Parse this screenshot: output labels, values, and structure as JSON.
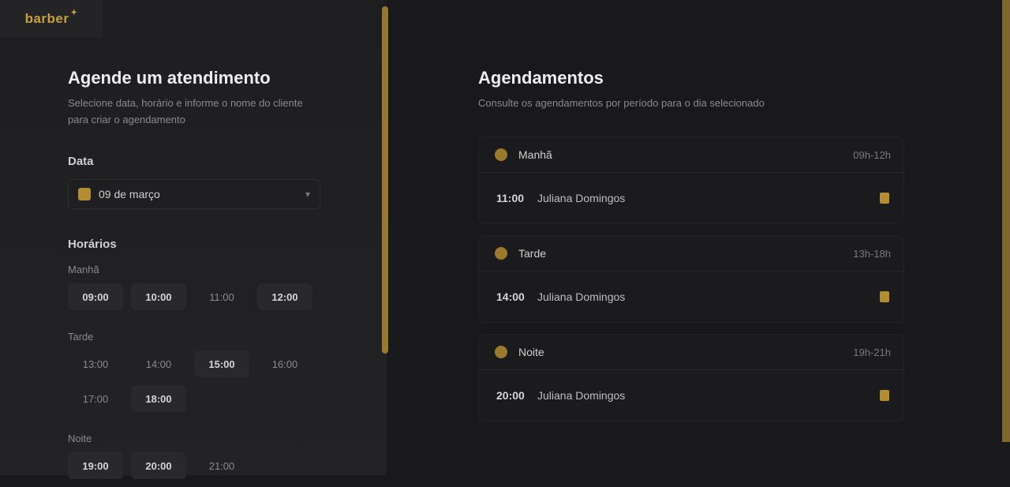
{
  "brand": {
    "name": "barber",
    "accent": "#c6a13c"
  },
  "left": {
    "title": "Agende um atendimento",
    "subtitle": "Selecione data, horário e informe o nome do cliente para criar o agendamento",
    "date_label": "Data",
    "date_value": "09 de março",
    "hours_label": "Horários",
    "periods": [
      {
        "name": "Manhã",
        "slots": [
          {
            "time": "09:00",
            "on": true
          },
          {
            "time": "10:00",
            "on": true
          },
          {
            "time": "11:00",
            "on": false
          },
          {
            "time": "12:00",
            "on": true
          }
        ]
      },
      {
        "name": "Tarde",
        "slots": [
          {
            "time": "13:00",
            "on": false
          },
          {
            "time": "14:00",
            "on": false
          },
          {
            "time": "15:00",
            "on": true
          },
          {
            "time": "16:00",
            "on": false
          },
          {
            "time": "17:00",
            "on": false
          },
          {
            "time": "18:00",
            "on": true
          }
        ]
      },
      {
        "name": "Noite",
        "slots": [
          {
            "time": "19:00",
            "on": true
          },
          {
            "time": "20:00",
            "on": true
          },
          {
            "time": "21:00",
            "on": false
          }
        ]
      }
    ]
  },
  "right": {
    "title": "Agendamentos",
    "subtitle": "Consulte os agendamentos por período para o dia selecionado",
    "periods": [
      {
        "name": "Manhã",
        "range": "09h-12h",
        "rows": [
          {
            "time": "11:00",
            "client": "Juliana Domingos"
          }
        ]
      },
      {
        "name": "Tarde",
        "range": "13h-18h",
        "rows": [
          {
            "time": "14:00",
            "client": "Juliana Domingos"
          }
        ]
      },
      {
        "name": "Noite",
        "range": "19h-21h",
        "rows": [
          {
            "time": "20:00",
            "client": "Juliana Domingos"
          }
        ]
      }
    ]
  }
}
